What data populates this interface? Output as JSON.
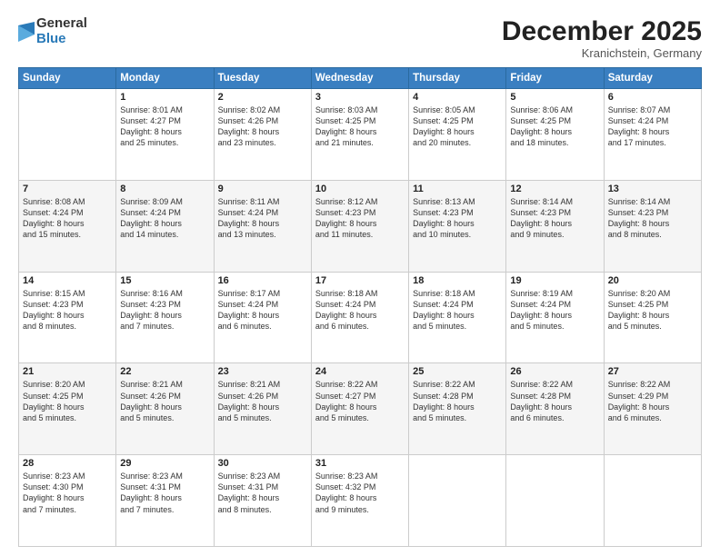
{
  "logo": {
    "general": "General",
    "blue": "Blue"
  },
  "title": "December 2025",
  "location": "Kranichstein, Germany",
  "days_of_week": [
    "Sunday",
    "Monday",
    "Tuesday",
    "Wednesday",
    "Thursday",
    "Friday",
    "Saturday"
  ],
  "weeks": [
    [
      {
        "day": "",
        "info": ""
      },
      {
        "day": "1",
        "info": "Sunrise: 8:01 AM\nSunset: 4:27 PM\nDaylight: 8 hours\nand 25 minutes."
      },
      {
        "day": "2",
        "info": "Sunrise: 8:02 AM\nSunset: 4:26 PM\nDaylight: 8 hours\nand 23 minutes."
      },
      {
        "day": "3",
        "info": "Sunrise: 8:03 AM\nSunset: 4:25 PM\nDaylight: 8 hours\nand 21 minutes."
      },
      {
        "day": "4",
        "info": "Sunrise: 8:05 AM\nSunset: 4:25 PM\nDaylight: 8 hours\nand 20 minutes."
      },
      {
        "day": "5",
        "info": "Sunrise: 8:06 AM\nSunset: 4:25 PM\nDaylight: 8 hours\nand 18 minutes."
      },
      {
        "day": "6",
        "info": "Sunrise: 8:07 AM\nSunset: 4:24 PM\nDaylight: 8 hours\nand 17 minutes."
      }
    ],
    [
      {
        "day": "7",
        "info": "Sunrise: 8:08 AM\nSunset: 4:24 PM\nDaylight: 8 hours\nand 15 minutes."
      },
      {
        "day": "8",
        "info": "Sunrise: 8:09 AM\nSunset: 4:24 PM\nDaylight: 8 hours\nand 14 minutes."
      },
      {
        "day": "9",
        "info": "Sunrise: 8:11 AM\nSunset: 4:24 PM\nDaylight: 8 hours\nand 13 minutes."
      },
      {
        "day": "10",
        "info": "Sunrise: 8:12 AM\nSunset: 4:23 PM\nDaylight: 8 hours\nand 11 minutes."
      },
      {
        "day": "11",
        "info": "Sunrise: 8:13 AM\nSunset: 4:23 PM\nDaylight: 8 hours\nand 10 minutes."
      },
      {
        "day": "12",
        "info": "Sunrise: 8:14 AM\nSunset: 4:23 PM\nDaylight: 8 hours\nand 9 minutes."
      },
      {
        "day": "13",
        "info": "Sunrise: 8:14 AM\nSunset: 4:23 PM\nDaylight: 8 hours\nand 8 minutes."
      }
    ],
    [
      {
        "day": "14",
        "info": "Sunrise: 8:15 AM\nSunset: 4:23 PM\nDaylight: 8 hours\nand 8 minutes."
      },
      {
        "day": "15",
        "info": "Sunrise: 8:16 AM\nSunset: 4:23 PM\nDaylight: 8 hours\nand 7 minutes."
      },
      {
        "day": "16",
        "info": "Sunrise: 8:17 AM\nSunset: 4:24 PM\nDaylight: 8 hours\nand 6 minutes."
      },
      {
        "day": "17",
        "info": "Sunrise: 8:18 AM\nSunset: 4:24 PM\nDaylight: 8 hours\nand 6 minutes."
      },
      {
        "day": "18",
        "info": "Sunrise: 8:18 AM\nSunset: 4:24 PM\nDaylight: 8 hours\nand 5 minutes."
      },
      {
        "day": "19",
        "info": "Sunrise: 8:19 AM\nSunset: 4:24 PM\nDaylight: 8 hours\nand 5 minutes."
      },
      {
        "day": "20",
        "info": "Sunrise: 8:20 AM\nSunset: 4:25 PM\nDaylight: 8 hours\nand 5 minutes."
      }
    ],
    [
      {
        "day": "21",
        "info": "Sunrise: 8:20 AM\nSunset: 4:25 PM\nDaylight: 8 hours\nand 5 minutes."
      },
      {
        "day": "22",
        "info": "Sunrise: 8:21 AM\nSunset: 4:26 PM\nDaylight: 8 hours\nand 5 minutes."
      },
      {
        "day": "23",
        "info": "Sunrise: 8:21 AM\nSunset: 4:26 PM\nDaylight: 8 hours\nand 5 minutes."
      },
      {
        "day": "24",
        "info": "Sunrise: 8:22 AM\nSunset: 4:27 PM\nDaylight: 8 hours\nand 5 minutes."
      },
      {
        "day": "25",
        "info": "Sunrise: 8:22 AM\nSunset: 4:28 PM\nDaylight: 8 hours\nand 5 minutes."
      },
      {
        "day": "26",
        "info": "Sunrise: 8:22 AM\nSunset: 4:28 PM\nDaylight: 8 hours\nand 6 minutes."
      },
      {
        "day": "27",
        "info": "Sunrise: 8:22 AM\nSunset: 4:29 PM\nDaylight: 8 hours\nand 6 minutes."
      }
    ],
    [
      {
        "day": "28",
        "info": "Sunrise: 8:23 AM\nSunset: 4:30 PM\nDaylight: 8 hours\nand 7 minutes."
      },
      {
        "day": "29",
        "info": "Sunrise: 8:23 AM\nSunset: 4:31 PM\nDaylight: 8 hours\nand 7 minutes."
      },
      {
        "day": "30",
        "info": "Sunrise: 8:23 AM\nSunset: 4:31 PM\nDaylight: 8 hours\nand 8 minutes."
      },
      {
        "day": "31",
        "info": "Sunrise: 8:23 AM\nSunset: 4:32 PM\nDaylight: 8 hours\nand 9 minutes."
      },
      {
        "day": "",
        "info": ""
      },
      {
        "day": "",
        "info": ""
      },
      {
        "day": "",
        "info": ""
      }
    ]
  ]
}
